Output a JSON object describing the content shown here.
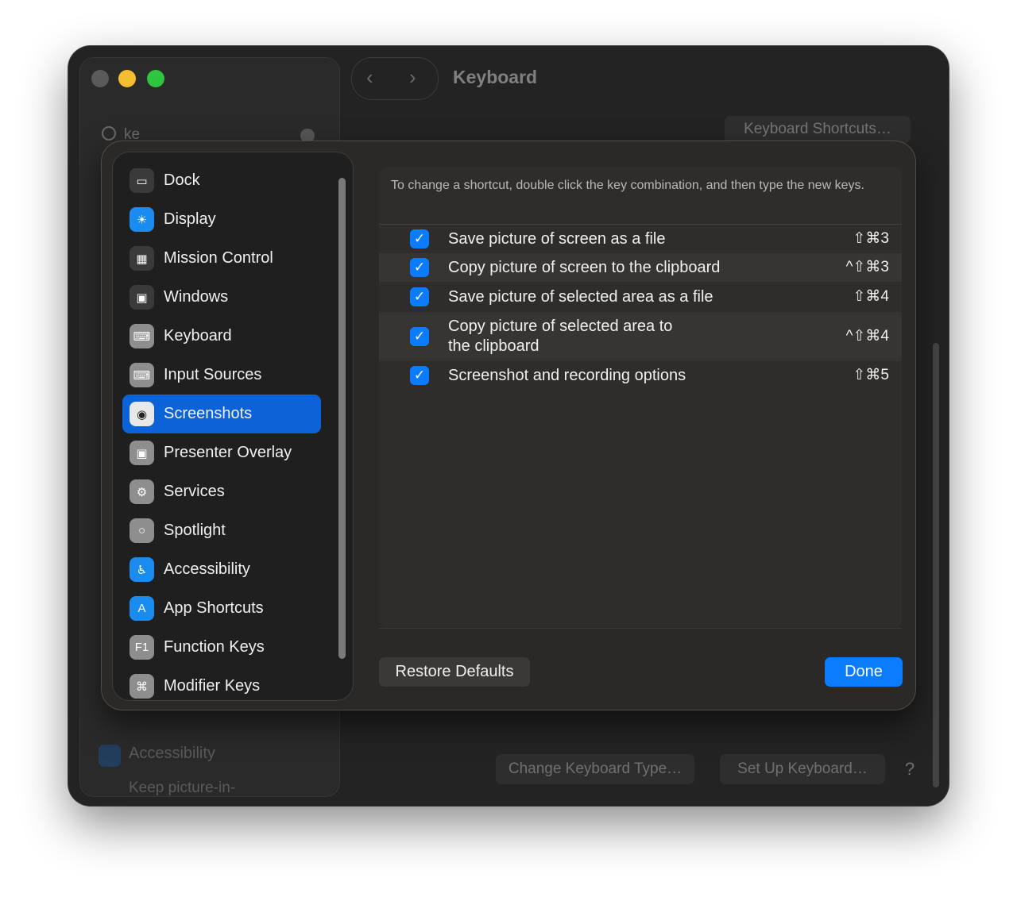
{
  "window": {
    "title": "Keyboard",
    "search": {
      "value": "ke"
    },
    "keyboard_shortcuts_button": "Keyboard Shortcuts…",
    "change_keyboard_type_button": "Change Keyboard Type…",
    "set_up_keyboard_button": "Set Up Keyboard…",
    "help_button": "?",
    "sidebar_peek": {
      "label": "Accessibility",
      "subtext": "Keep picture-in-"
    }
  },
  "sheet": {
    "categories": [
      {
        "label": "Dock",
        "icon": "dock-icon",
        "color": "#3a3a3a",
        "glyph": "▭"
      },
      {
        "label": "Display",
        "icon": "display-brightness-icon",
        "color": "#1a8cf0",
        "glyph": "☀"
      },
      {
        "label": "Mission Control",
        "icon": "mission-control-icon",
        "color": "#3a3a3a",
        "glyph": "▦"
      },
      {
        "label": "Windows",
        "icon": "windows-icon",
        "color": "#3a3a3a",
        "glyph": "▣"
      },
      {
        "label": "Keyboard",
        "icon": "keyboard-icon",
        "color": "#8e8e8e",
        "glyph": "⌨"
      },
      {
        "label": "Input Sources",
        "icon": "input-sources-icon",
        "color": "#8e8e8e",
        "glyph": "⌨"
      },
      {
        "label": "Screenshots",
        "icon": "screenshot-camera-icon",
        "color": "#e8e8e8",
        "glyph": "◉",
        "selected": true
      },
      {
        "label": "Presenter Overlay",
        "icon": "presenter-overlay-icon",
        "color": "#8e8e8e",
        "glyph": "▣"
      },
      {
        "label": "Services",
        "icon": "services-gears-icon",
        "color": "#8e8e8e",
        "glyph": "⚙"
      },
      {
        "label": "Spotlight",
        "icon": "spotlight-search-icon",
        "color": "#8e8e8e",
        "glyph": "○"
      },
      {
        "label": "Accessibility",
        "icon": "accessibility-icon",
        "color": "#1a8cf0",
        "glyph": "♿"
      },
      {
        "label": "App Shortcuts",
        "icon": "app-store-icon",
        "color": "#1a8cf0",
        "glyph": "A"
      },
      {
        "label": "Function Keys",
        "icon": "function-key-icon",
        "color": "#8e8e8e",
        "glyph": "F1"
      },
      {
        "label": "Modifier Keys",
        "icon": "command-key-icon",
        "color": "#8e8e8e",
        "glyph": "⌘"
      }
    ],
    "instructions": "To change a shortcut, double click the key combination, and then type the new keys.",
    "shortcuts": [
      {
        "label": "Save picture of screen as a file",
        "keys": "⇧⌘3",
        "checked": true
      },
      {
        "label": "Copy picture of screen to the clipboard",
        "keys": "^⇧⌘3",
        "checked": true
      },
      {
        "label": "Save picture of selected area as a file",
        "keys": "⇧⌘4",
        "checked": true
      },
      {
        "label": "Copy picture of selected area to\nthe clipboard",
        "keys": "^⇧⌘4",
        "checked": true
      },
      {
        "label": "Screenshot and recording options",
        "keys": "⇧⌘5",
        "checked": true
      }
    ],
    "restore_defaults_button": "Restore Defaults",
    "done_button": "Done"
  },
  "colors": {
    "accent": "#0b7cff",
    "selection": "#0c63d8",
    "window_bg": "#232323",
    "sheet_bg": "#2b2928"
  }
}
